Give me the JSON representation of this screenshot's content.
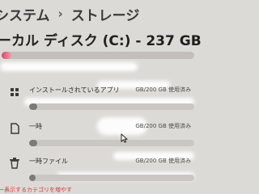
{
  "breadcrumb": {
    "root": "システム",
    "separator": "›",
    "current": "ストレージ"
  },
  "drive": {
    "title": "ーカル ディスク (C:) - 237 GB",
    "usage_fraction": 0.05,
    "accent_color": "#d44a6b"
  },
  "categories": [
    {
      "label": "インストールされているアプリ",
      "usage": "GB/200 GB 使用済み",
      "icon": "apps-icon",
      "fill_fraction": 0.05
    },
    {
      "label": "一時",
      "usage": "GB/200 GB 使用済み",
      "icon": "document-icon",
      "fill_fraction": 0.05
    },
    {
      "label": "一時ファイル",
      "usage": "GB/200 GB 使用済み",
      "icon": "trash-icon",
      "fill_fraction": 0.04
    }
  ],
  "footer": {
    "link": "ー表示するカテゴリを増やす"
  }
}
